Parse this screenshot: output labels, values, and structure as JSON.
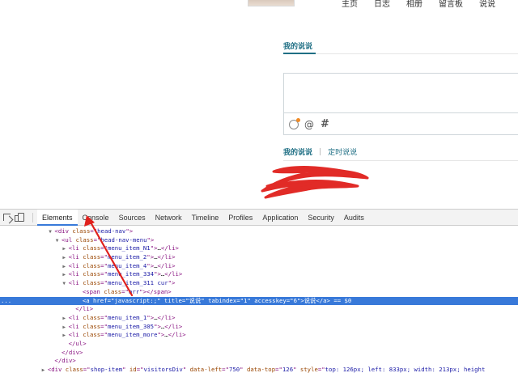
{
  "site": {
    "nav": [
      "主页",
      "日志",
      "相册",
      "留言板",
      "说说"
    ],
    "section_title": "我的说说",
    "tabs": {
      "active": "我的说说",
      "separator": "|",
      "other": "定时说说"
    },
    "composer_icons": [
      "emoji-icon",
      "at-icon",
      "hash-icon"
    ],
    "at_glyph": "@",
    "hash_glyph": "#"
  },
  "devtools": {
    "tabs": [
      "Elements",
      "Console",
      "Sources",
      "Network",
      "Timeline",
      "Profiles",
      "Application",
      "Security",
      "Audits"
    ],
    "active_tab": "Elements",
    "dom_lines": [
      {
        "indent": 7,
        "tri": "▼",
        "parts": [
          [
            "tg",
            "<div "
          ],
          [
            "an",
            "class"
          ],
          [
            "tg",
            "=\""
          ],
          [
            "av",
            "head-nav"
          ],
          [
            "tg",
            "\">"
          ]
        ]
      },
      {
        "indent": 8,
        "tri": "▼",
        "parts": [
          [
            "tg",
            "<ul "
          ],
          [
            "an",
            "class"
          ],
          [
            "tg",
            "=\""
          ],
          [
            "av",
            "head-nav-menu"
          ],
          [
            "tg",
            "\">"
          ]
        ]
      },
      {
        "indent": 9,
        "tri": "▶",
        "parts": [
          [
            "tg",
            "<li "
          ],
          [
            "an",
            "class"
          ],
          [
            "tg",
            "=\""
          ],
          [
            "av",
            "menu_item_N1"
          ],
          [
            "tg",
            "\">"
          ],
          [
            "txt",
            "…"
          ],
          [
            "tg",
            "</li>"
          ]
        ]
      },
      {
        "indent": 9,
        "tri": "▶",
        "parts": [
          [
            "tg",
            "<li "
          ],
          [
            "an",
            "class"
          ],
          [
            "tg",
            "=\""
          ],
          [
            "av",
            "menu_item_2"
          ],
          [
            "tg",
            "\">"
          ],
          [
            "txt",
            "…"
          ],
          [
            "tg",
            "</li>"
          ]
        ]
      },
      {
        "indent": 9,
        "tri": "▶",
        "parts": [
          [
            "tg",
            "<li "
          ],
          [
            "an",
            "class"
          ],
          [
            "tg",
            "=\""
          ],
          [
            "av",
            "menu_item_4"
          ],
          [
            "tg",
            "\">"
          ],
          [
            "txt",
            "…"
          ],
          [
            "tg",
            "</li>"
          ]
        ]
      },
      {
        "indent": 9,
        "tri": "▶",
        "parts": [
          [
            "tg",
            "<li "
          ],
          [
            "an",
            "class"
          ],
          [
            "tg",
            "=\""
          ],
          [
            "av",
            "menu_item_334"
          ],
          [
            "tg",
            "\">"
          ],
          [
            "txt",
            "…"
          ],
          [
            "tg",
            "</li>"
          ]
        ]
      },
      {
        "indent": 9,
        "tri": "▼",
        "parts": [
          [
            "tg",
            "<li "
          ],
          [
            "an",
            "class"
          ],
          [
            "tg",
            "=\""
          ],
          [
            "av",
            "menu_item_311 cur"
          ],
          [
            "tg",
            "\">"
          ]
        ]
      },
      {
        "indent": 11,
        "tri": "",
        "parts": [
          [
            "tg",
            "<span "
          ],
          [
            "an",
            "class"
          ],
          [
            "tg",
            "=\""
          ],
          [
            "av",
            "arr"
          ],
          [
            "tg",
            "\"></span>"
          ]
        ]
      },
      {
        "indent": 11,
        "tri": "",
        "selected": true,
        "parts": [
          [
            "tg",
            "<a "
          ],
          [
            "an",
            "href"
          ],
          [
            "tg",
            "=\""
          ],
          [
            "av",
            "javascript:;"
          ],
          [
            "tg",
            "\" "
          ],
          [
            "an",
            "title"
          ],
          [
            "tg",
            "=\""
          ],
          [
            "av",
            "说说"
          ],
          [
            "tg",
            "\" "
          ],
          [
            "an",
            "tabindex"
          ],
          [
            "tg",
            "=\""
          ],
          [
            "av",
            "1"
          ],
          [
            "tg",
            "\" "
          ],
          [
            "an",
            "accesskey"
          ],
          [
            "tg",
            "=\""
          ],
          [
            "av",
            "6"
          ],
          [
            "tg",
            "\">"
          ],
          [
            "txt",
            "说说"
          ],
          [
            "tg",
            "</a>"
          ],
          [
            "txt",
            " == $0"
          ]
        ]
      },
      {
        "indent": 10,
        "tri": "",
        "parts": [
          [
            "tg",
            "</li>"
          ]
        ]
      },
      {
        "indent": 9,
        "tri": "▶",
        "parts": [
          [
            "tg",
            "<li "
          ],
          [
            "an",
            "class"
          ],
          [
            "tg",
            "=\""
          ],
          [
            "av",
            "menu_item_1"
          ],
          [
            "tg",
            "\">"
          ],
          [
            "txt",
            "…"
          ],
          [
            "tg",
            "</li>"
          ]
        ]
      },
      {
        "indent": 9,
        "tri": "▶",
        "parts": [
          [
            "tg",
            "<li "
          ],
          [
            "an",
            "class"
          ],
          [
            "tg",
            "=\""
          ],
          [
            "av",
            "menu_item_305"
          ],
          [
            "tg",
            "\">"
          ],
          [
            "txt",
            "…"
          ],
          [
            "tg",
            "</li>"
          ]
        ]
      },
      {
        "indent": 9,
        "tri": "▶",
        "parts": [
          [
            "tg",
            "<li "
          ],
          [
            "an",
            "class"
          ],
          [
            "tg",
            "=\""
          ],
          [
            "av",
            "menu_item_more"
          ],
          [
            "tg",
            "\">"
          ],
          [
            "txt",
            "…"
          ],
          [
            "tg",
            "</li>"
          ]
        ]
      },
      {
        "indent": 9,
        "tri": "",
        "parts": [
          [
            "tg",
            "</ul>"
          ]
        ]
      },
      {
        "indent": 8,
        "tri": "",
        "parts": [
          [
            "tg",
            "</div>"
          ]
        ]
      },
      {
        "indent": 7,
        "tri": "",
        "parts": [
          [
            "tg",
            "</div>"
          ]
        ]
      },
      {
        "indent": 6,
        "tri": "▶",
        "parts": [
          [
            "tg",
            "<div "
          ],
          [
            "an",
            "class"
          ],
          [
            "tg",
            "=\""
          ],
          [
            "av",
            "shop-item"
          ],
          [
            "tg",
            "\" "
          ],
          [
            "an",
            "id"
          ],
          [
            "tg",
            "=\""
          ],
          [
            "av",
            "visitorsDiv"
          ],
          [
            "tg",
            "\" "
          ],
          [
            "an",
            "data-left"
          ],
          [
            "tg",
            "=\""
          ],
          [
            "av",
            "750"
          ],
          [
            "tg",
            "\" "
          ],
          [
            "an",
            "data-top"
          ],
          [
            "tg",
            "=\""
          ],
          [
            "av",
            "126"
          ],
          [
            "tg",
            "\" "
          ],
          [
            "an",
            "style"
          ],
          [
            "tg",
            "=\""
          ],
          [
            "av",
            "top: 126px; left: 833px; width: 213px; height"
          ]
        ]
      }
    ],
    "selected_marker": "..."
  },
  "colors": {
    "accent": "#1f6f84",
    "devtools_selection": "#3879d9",
    "annotation_red": "#e0201c",
    "tag": "#881280",
    "attr_name": "#994500",
    "attr_value": "#1a1aa6"
  }
}
